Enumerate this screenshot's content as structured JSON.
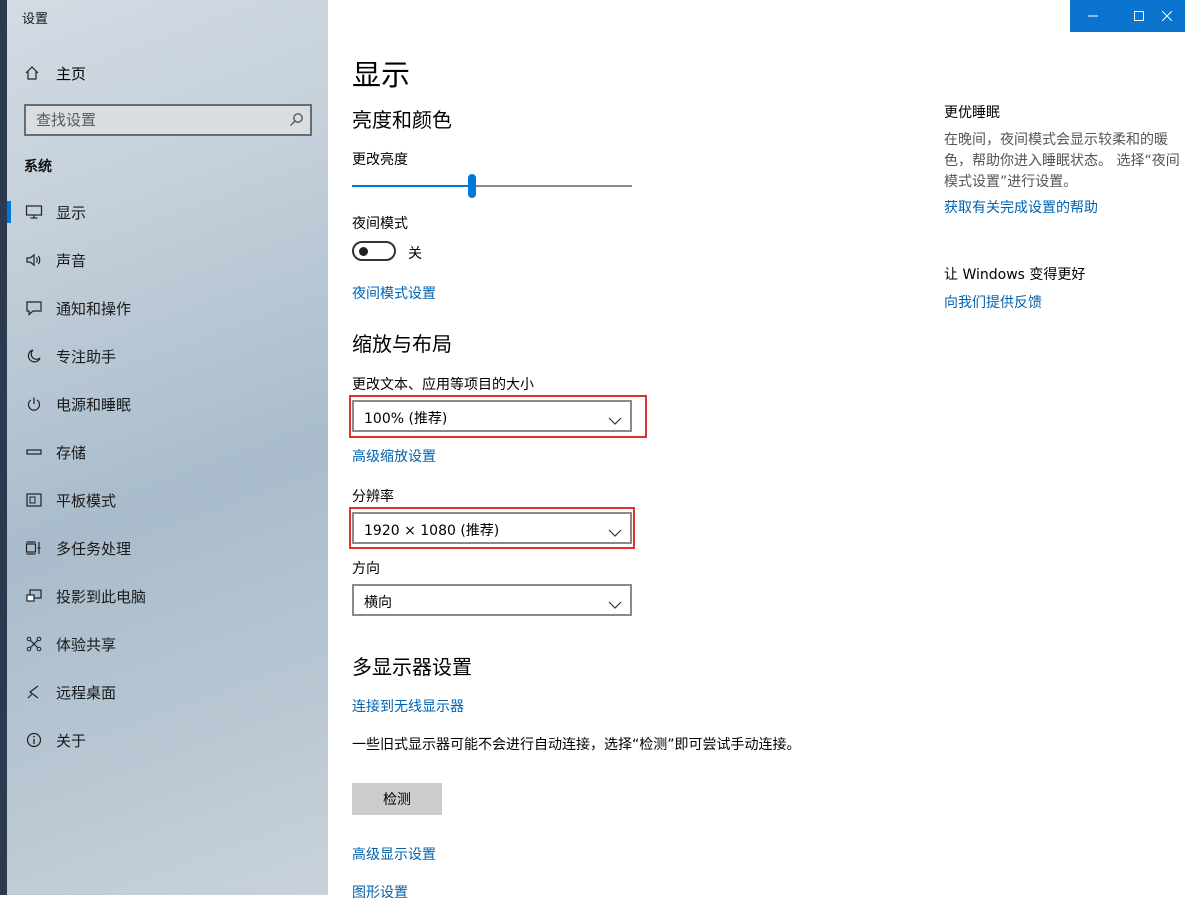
{
  "window": {
    "title": "设置"
  },
  "sidebar": {
    "home": "主页",
    "search_placeholder": "查找设置",
    "section": "系统",
    "items": [
      {
        "label": "显示",
        "icon": "monitor-icon",
        "active": true
      },
      {
        "label": "声音",
        "icon": "speaker-icon"
      },
      {
        "label": "通知和操作",
        "icon": "message-icon"
      },
      {
        "label": "专注助手",
        "icon": "moon-icon"
      },
      {
        "label": "电源和睡眠",
        "icon": "power-icon"
      },
      {
        "label": "存储",
        "icon": "storage-icon"
      },
      {
        "label": "平板模式",
        "icon": "tablet-icon"
      },
      {
        "label": "多任务处理",
        "icon": "multitask-icon"
      },
      {
        "label": "投影到此电脑",
        "icon": "project-icon"
      },
      {
        "label": "体验共享",
        "icon": "share-icon"
      },
      {
        "label": "远程桌面",
        "icon": "remote-icon"
      },
      {
        "label": "关于",
        "icon": "info-icon"
      }
    ]
  },
  "main": {
    "title": "显示",
    "brightness_heading": "亮度和颜色",
    "brightness_label": "更改亮度",
    "brightness_value": 0.43,
    "night_label": "夜间模式",
    "night_state": "关",
    "night_link": "夜间模式设置",
    "scale_heading": "缩放与布局",
    "scale_label": "更改文本、应用等项目的大小",
    "scale_value": "100% (推荐)",
    "scale_link": "高级缩放设置",
    "resolution_label": "分辨率",
    "resolution_value": "1920 × 1080 (推荐)",
    "orientation_label": "方向",
    "orientation_value": "横向",
    "multi_heading": "多显示器设置",
    "wireless_link": "连接到无线显示器",
    "detect_text": "一些旧式显示器可能不会进行自动连接，选择“检测”即可尝试手动连接。",
    "detect_button": "检测",
    "advanced_link": "高级显示设置",
    "graphics_link": "图形设置"
  },
  "right": {
    "sleep_heading": "更优睡眠",
    "sleep_text": "在晚间，夜间模式会显示较柔和的暖色，帮助你进入睡眠状态。 选择“夜间模式设置”进行设置。",
    "sleep_link": "获取有关完成设置的帮助",
    "improve_heading": "让 Windows 变得更好",
    "feedback_link": "向我们提供反馈"
  },
  "colors": {
    "accent": "#0078d7",
    "link": "#0063b1",
    "highlight": "#e03030"
  }
}
